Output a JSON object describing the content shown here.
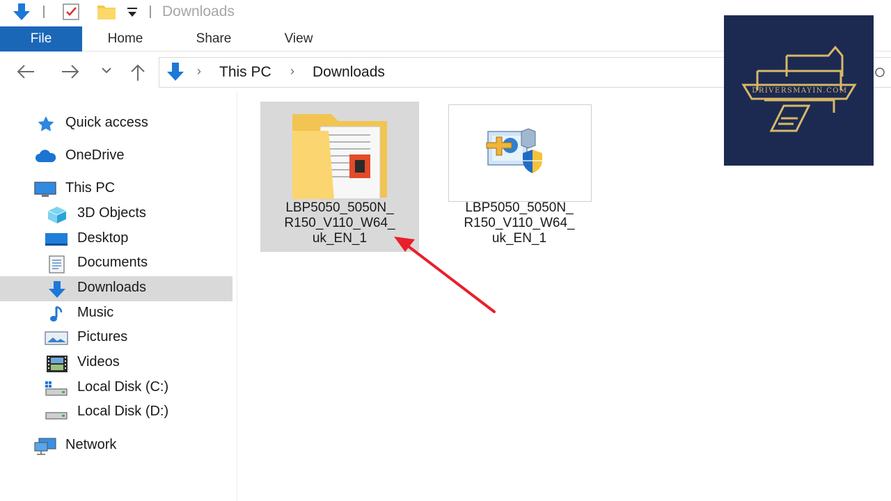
{
  "window": {
    "title": "Downloads"
  },
  "ribbon": {
    "tabs": [
      "File",
      "Home",
      "Share",
      "View"
    ]
  },
  "address": {
    "items": [
      "This PC",
      "Downloads"
    ],
    "separator": "›"
  },
  "sidebar": {
    "items": [
      {
        "label": "Quick access",
        "icon": "star-icon"
      },
      {
        "label": "OneDrive",
        "icon": "cloud-icon"
      },
      {
        "label": "This PC",
        "icon": "computer-icon"
      },
      {
        "label": "3D Objects",
        "icon": "cube-icon"
      },
      {
        "label": "Desktop",
        "icon": "desktop-icon"
      },
      {
        "label": "Documents",
        "icon": "document-icon"
      },
      {
        "label": "Downloads",
        "icon": "download-arrow-icon",
        "selected": true
      },
      {
        "label": "Music",
        "icon": "music-note-icon"
      },
      {
        "label": "Pictures",
        "icon": "pictures-icon"
      },
      {
        "label": "Videos",
        "icon": "film-icon"
      },
      {
        "label": "Local Disk (C:)",
        "icon": "drive-c-icon"
      },
      {
        "label": "Local Disk (D:)",
        "icon": "drive-d-icon"
      },
      {
        "label": "Network",
        "icon": "network-icon"
      }
    ]
  },
  "files": [
    {
      "name_lines": [
        "LBP5050_5050N_",
        "R150_V110_W64_",
        "uk_EN_1"
      ],
      "type": "folder",
      "selected": true
    },
    {
      "name_lines": [
        "LBP5050_5050N_",
        "R150_V110_W64_",
        "uk_EN_1"
      ],
      "type": "installer"
    }
  ],
  "watermark": {
    "text": "DRIVERSMAYIN.COM"
  },
  "colors": {
    "accent": "#1a67b8",
    "selection": "#d9d9d9",
    "annotation_arrow": "#e8202a",
    "logo_bg": "#1c2a52",
    "logo_gold": "#d7b866"
  }
}
